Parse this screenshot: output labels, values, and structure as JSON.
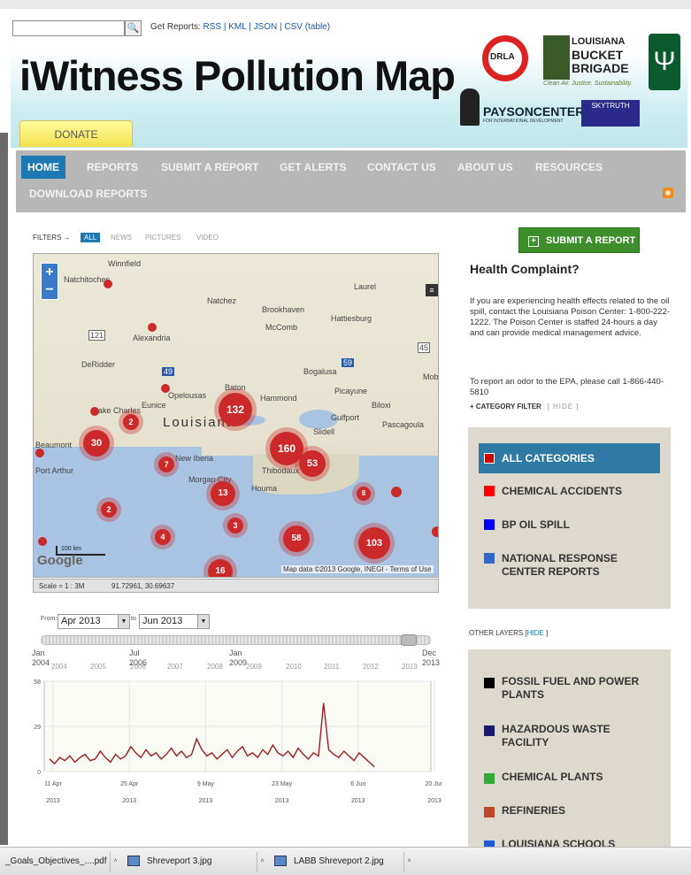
{
  "header": {
    "search_button": "🔍",
    "get_reports_label": "Get Reports:",
    "get_reports_links": "RSS | KML | JSON | CSV (table)",
    "title": "iWitness Pollution Map",
    "donate": "DONATE",
    "logos": {
      "drla": "DRLA",
      "lbb_line1": "LOUISIANA",
      "lbb_line2": "BUCKET",
      "lbb_line3": "BRIGADE",
      "lbb_tagline": "Clean Air. Justice. Sustainability.",
      "tulane": "Ψ",
      "payson": "PAYSONCENTER",
      "payson_sub": "FOR INTERNATIONAL DEVELOPMENT",
      "skytruth": "SKYTRUTH"
    }
  },
  "nav": {
    "items": [
      "HOME",
      "REPORTS",
      "SUBMIT A REPORT",
      "GET ALERTS",
      "CONTACT US",
      "ABOUT US",
      "RESOURCES",
      "DOWNLOAD REPORTS"
    ],
    "rss_icon": "rss-icon"
  },
  "filters": {
    "label": "FILTERS",
    "arrow": "→",
    "options": [
      "ALL",
      "NEWS",
      "PICTURES",
      "VIDEO"
    ]
  },
  "map": {
    "labels": [
      "Winnfield",
      "Natchitoches",
      "Natchez",
      "Laurel",
      "Brookhaven",
      "McComb",
      "Hattiesburg",
      "Alexandria",
      "DeRidder",
      "Bogalusa",
      "Opelousas",
      "Baton",
      "Hammond",
      "Picayune",
      "Biloxi",
      "Lake Charles",
      "Eunice",
      "Gulfport",
      "Pascagoula",
      "Louisiana",
      "Beaumont",
      "Slidell",
      "Port Arthur",
      "New Iberia",
      "Morgan City",
      "Thibodaux",
      "Houma",
      "Mob"
    ],
    "road_labels": [
      "121",
      "49",
      "59",
      "45"
    ],
    "clusters": [
      "132",
      "160",
      "53",
      "30",
      "2",
      "7",
      "13",
      "2",
      "4",
      "3",
      "58",
      "103",
      "16",
      "8"
    ],
    "zoom_in": "+",
    "zoom_out": "−",
    "scale_text": "100 km",
    "google": "Google",
    "attribution": "Map data ©2013 Google, INEGI - Terms of Use",
    "scale_info": "Scale = 1 : 3M",
    "coords": "91.72961, 30.69637"
  },
  "sidebar": {
    "submit_button": "SUBMIT A REPORT",
    "health_title": "Health Complaint?",
    "health_text": "If you are experiencing health effects related to the oil spill, contact the Louisiana Poison Center: 1-800-222-1222. The Poison Center is staffed 24-hours a day and can provide medical management advice.",
    "epa_text": "To report an odor to the EPA, please call 1-866-440-5810",
    "category_filter": "+ CATEGORY FILTER",
    "category_hide": "[ HIDE ]",
    "categories": [
      {
        "label": "ALL CATEGORIES",
        "color": "#cc0000"
      },
      {
        "label": "CHEMICAL ACCIDENTS",
        "color": "#ff0000"
      },
      {
        "label": "BP OIL SPILL",
        "color": "#0000ff"
      },
      {
        "label": "NATIONAL RESPONSE CENTER REPORTS",
        "color": "#3366cc"
      }
    ],
    "other_layers": "OTHER LAYERS [",
    "other_hide": "HIDE",
    "other_close": "]",
    "layers": [
      {
        "label": "FOSSIL FUEL AND POWER PLANTS",
        "color": "#000000"
      },
      {
        "label": "HAZARDOUS WASTE FACILITY",
        "color": "#1a1a6e"
      },
      {
        "label": "CHEMICAL PLANTS",
        "color": "#33aa33"
      },
      {
        "label": "REFINERIES",
        "color": "#c0462a"
      },
      {
        "label": "LOUISIANA SCHOOLS",
        "color": "#1a5ad6"
      }
    ]
  },
  "timeline": {
    "from_label": "From:",
    "from_value": "Apr 2013",
    "to_label": "to",
    "to_value": "Jun 2013",
    "major_ticks": [
      "Jan\n2004",
      "Jul\n2006",
      "Jan\n2009",
      "Dec\n2013"
    ],
    "minor_ticks": [
      "2004",
      "2005",
      "2006",
      "2007",
      "2008",
      "2009",
      "2010",
      "2011",
      "2012",
      "2013"
    ]
  },
  "chart_data": {
    "type": "line",
    "ylim": [
      0,
      58
    ],
    "y_ticks": [
      "58",
      "29",
      "0"
    ],
    "x_tick_labels": [
      {
        "l1": "11 Apr",
        "l2": "2013"
      },
      {
        "l1": "25 Apr",
        "l2": "2013"
      },
      {
        "l1": "9 May",
        "l2": "2013"
      },
      {
        "l1": "23 May",
        "l2": "2013"
      },
      {
        "l1": "6 Jun",
        "l2": "2013"
      },
      {
        "l1": "20 Jun",
        "l2": "2013"
      }
    ],
    "series": [
      {
        "color": "#9b1c1c",
        "values": [
          8,
          5,
          9,
          7,
          10,
          6,
          9,
          11,
          7,
          8,
          13,
          9,
          6,
          11,
          8,
          10,
          16,
          12,
          9,
          14,
          10,
          12,
          8,
          11,
          15,
          10,
          13,
          9,
          11,
          21,
          14,
          10,
          12,
          8,
          11,
          14,
          9,
          13,
          16,
          10,
          12,
          9,
          14,
          11,
          17,
          12,
          10,
          13,
          9,
          15,
          11,
          8,
          12,
          10,
          44,
          14,
          11,
          9,
          13,
          10,
          7,
          12,
          9,
          6,
          3
        ]
      }
    ]
  },
  "taskbar": {
    "items": [
      "_Goals_Objectives_....pdf",
      "Shreveport 3.jpg",
      "LABB Shreveport 2.jpg"
    ],
    "arrow": "˄"
  }
}
